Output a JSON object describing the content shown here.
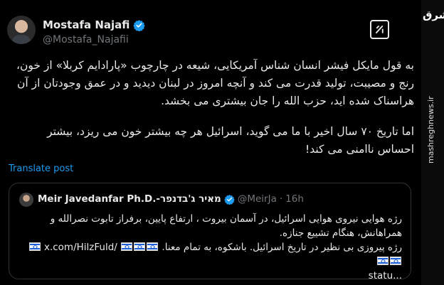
{
  "author": {
    "display_name": "Mostafa Najafi",
    "handle": "@Mostafa_Najafii"
  },
  "tweet": {
    "paragraph_1": "به قول مایکل فیشر انسان شناس آمریکایی، شیعه در چارچوب «پارادایم کربلا» از خون، رنج و مصیبت، تولید قدرت می کند و آنچه امروز در لبنان دیدید و در عمق وجودتان از آن هراسناک شده اید، حزب الله را جان بیشتری می بخشد.",
    "paragraph_2": "اما تاریخ ۷۰ سال اخیر با ما می گوید، اسرائیل هر چه بیشتر خون می ریزد، بیشتر احساس ناامنی می کند!",
    "translate_label": "Translate post"
  },
  "quote": {
    "display_name": "Meir Javedanfar Ph.D.-מאיר ג'בדנפר",
    "handle": "@MeirJa",
    "separator": "·",
    "time": "16h",
    "line_1": "رژه هوایی نیروی هوایی اسرائیل، در آسمان بیروت ، ارتفاع پایین، برفراز تابوت  نصرالله و همراهانش، هنگام تشییع جنازه.",
    "line_2_text": "رژه پیروزی بی نظیر در تاریخ اسرائیل. باشکوه، به تمام معنا.",
    "line_2_link": "x.com/HilzFuld/",
    "line_3": "statu..."
  },
  "watermark": {
    "logo_text": "مشرق",
    "url": "mashreghnews.ir"
  },
  "colors": {
    "background": "#000000",
    "text": "#e7e9ea",
    "secondary": "#71767b",
    "accent": "#1d9bf0",
    "border": "#2f3336"
  },
  "icons": {
    "verified": "verified-badge-icon",
    "grok": "grok-icon",
    "flag": "israel-flag-icon"
  }
}
